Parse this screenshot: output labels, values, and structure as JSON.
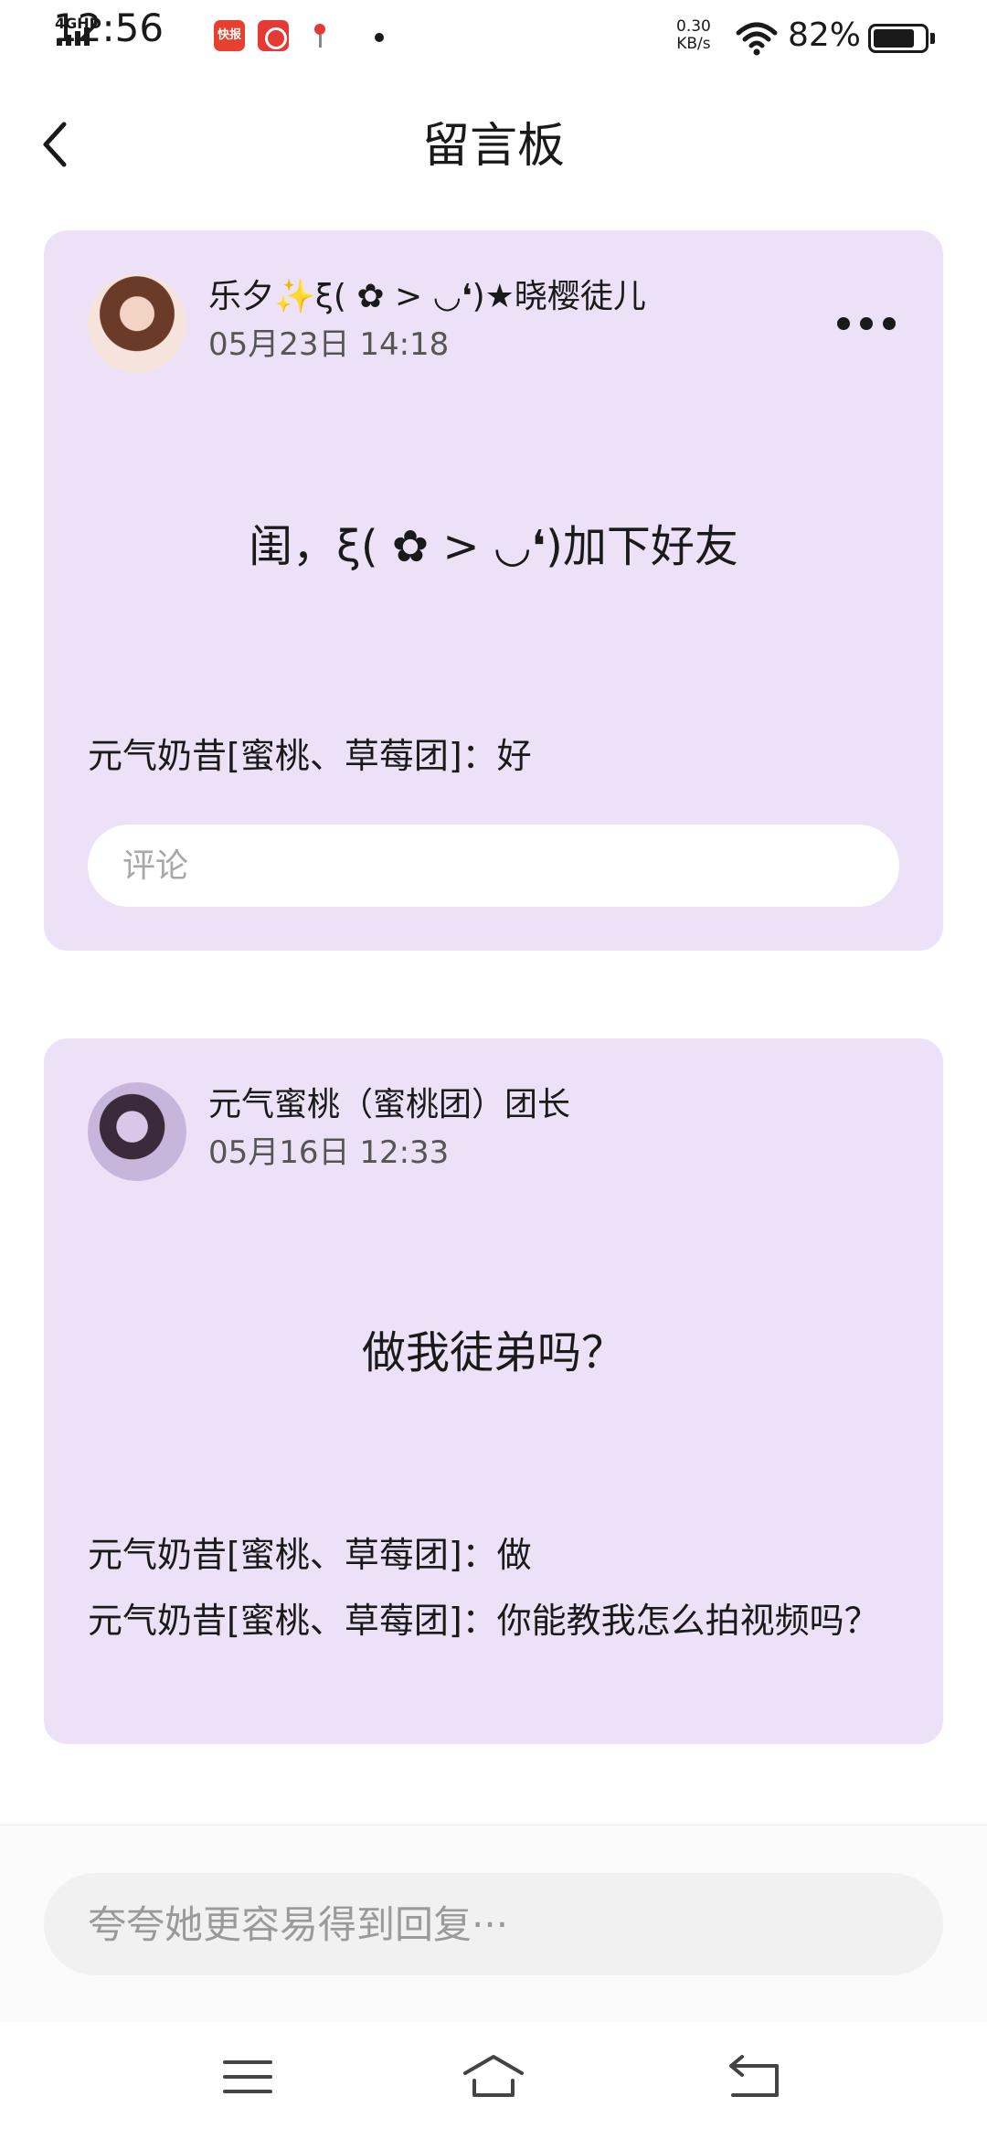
{
  "status_bar": {
    "network": "4GHD",
    "time": "12:56",
    "app_icons": [
      "kuaibao-app-icon",
      "pinduoduo-app-icon",
      "baidu-map-app-icon"
    ],
    "app1_label": "快报",
    "net_speed_value": "0.30",
    "net_speed_unit": "KB/s",
    "battery_percent": "82%",
    "battery_level": 0.82
  },
  "header": {
    "title": "留言板",
    "back_icon": "chevron-left-icon"
  },
  "posts": [
    {
      "author": "乐夕✨ξ( ✿ > ◡❛)★晓樱徒儿",
      "time": "05月23日 14:18",
      "message": "闺，ξ( ✿ > ◡❛)加下好友",
      "replies": [
        "元气奶昔[蜜桃、草莓团]：好"
      ],
      "comment_placeholder": "评论",
      "has_more_menu": true
    },
    {
      "author": "元气蜜桃（蜜桃团）团长",
      "time": "05月16日 12:33",
      "message": "做我徒弟吗？",
      "replies": [
        "元气奶昔[蜜桃、草莓团]：做",
        "元气奶昔[蜜桃、草莓团]：你能教我怎么拍视频吗？"
      ]
    }
  ],
  "bottom_input": {
    "placeholder": "夸夸她更容易得到回复···"
  },
  "nav_bar": {
    "icons": [
      "menu-icon",
      "home-icon",
      "back-icon"
    ]
  },
  "colors": {
    "card_background": "#ede1f7",
    "page_background": "#ffffff",
    "input_background": "#f1f1f1"
  }
}
